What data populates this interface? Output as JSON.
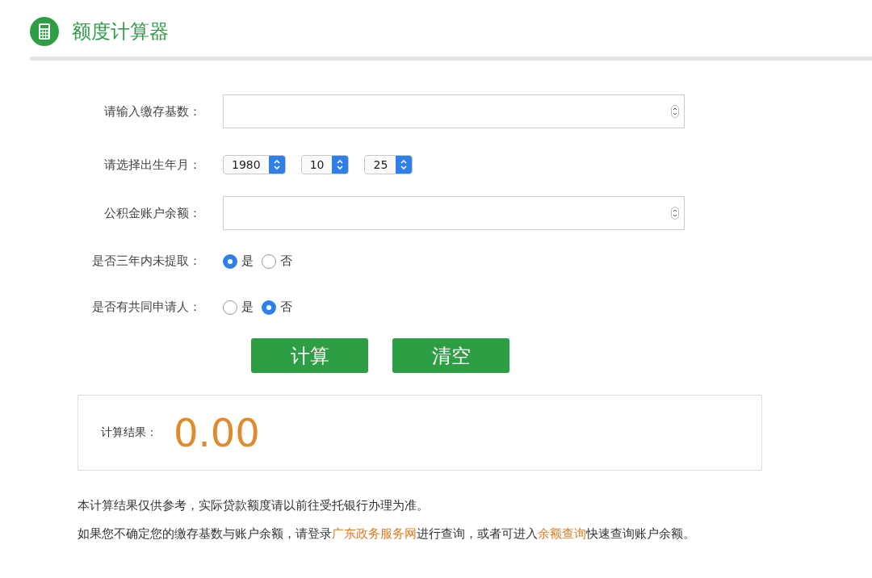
{
  "header": {
    "title": "额度计算器"
  },
  "form": [
    {
      "kind": "number",
      "label": "请输入缴存基数："
    },
    {
      "kind": "selects",
      "label": "请选择出生年月：",
      "selects": [
        {
          "value": "1980"
        },
        {
          "value": "10"
        },
        {
          "value": "25"
        }
      ]
    },
    {
      "kind": "number",
      "label": "公积金账户余额："
    },
    {
      "kind": "radio",
      "label": "是否三年内未提取：",
      "options": [
        {
          "label": "是",
          "selected": true
        },
        {
          "label": "否",
          "selected": false
        }
      ]
    },
    {
      "kind": "radio",
      "label": "是否有共同申请人：",
      "options": [
        {
          "label": "是",
          "selected": false
        },
        {
          "label": "否",
          "selected": true
        }
      ]
    }
  ],
  "buttons": [
    "计算",
    "清空"
  ],
  "result": {
    "label": "计算结果：",
    "value": "0.00"
  },
  "notes": [
    [
      {
        "kind": "text",
        "text": "本计算结果仅供参考，实际贷款额度请以前往受托银行办理为准。"
      }
    ],
    [
      {
        "kind": "text",
        "text": "如果您不确定您的缴存基数与账户余额，请登录"
      },
      {
        "kind": "link",
        "text": "广东政务服务网"
      },
      {
        "kind": "text",
        "text": "进行查询，或者可进入"
      },
      {
        "kind": "link",
        "text": "余额查询"
      },
      {
        "kind": "text",
        "text": "快速查询账户余额。"
      }
    ]
  ]
}
